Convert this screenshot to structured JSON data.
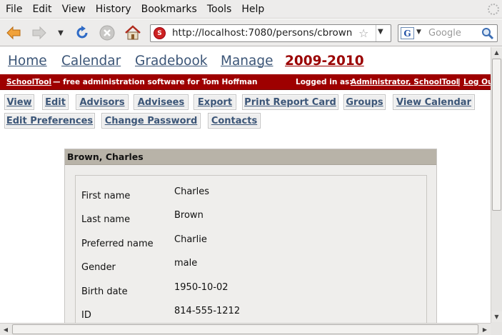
{
  "browser": {
    "menu": [
      {
        "label": "File"
      },
      {
        "label": "Edit"
      },
      {
        "label": "View"
      },
      {
        "label": "History"
      },
      {
        "label": "Bookmarks"
      },
      {
        "label": "Tools"
      },
      {
        "label": "Help"
      }
    ],
    "url": "http://localhost:7080/persons/cbrown",
    "search_placeholder": "Google",
    "search_engine_letter": "G"
  },
  "app": {
    "nav": [
      {
        "label": "Home"
      },
      {
        "label": "Calendar"
      },
      {
        "label": "Gradebook"
      },
      {
        "label": "Manage"
      },
      {
        "label": "2009-2010"
      }
    ],
    "header": {
      "brand": "SchoolTool",
      "tagline": " — free administration software for Tom Hoffman",
      "logged_in_label": "Logged in as:",
      "user": "Administrator, SchoolTool",
      "separator": "|",
      "logout": "Log Out"
    },
    "actions": [
      {
        "label": "View"
      },
      {
        "label": "Edit"
      },
      {
        "label": "Advisors"
      },
      {
        "label": "Advisees"
      },
      {
        "label": "Export"
      },
      {
        "label": "Print Report Card"
      },
      {
        "label": "Groups"
      },
      {
        "label": "View Calendar"
      },
      {
        "label": "Edit Preferences"
      },
      {
        "label": "Change Password"
      },
      {
        "label": "Contacts"
      }
    ]
  },
  "person": {
    "title": "Brown, Charles",
    "fields": [
      {
        "label": "First name",
        "value": "Charles"
      },
      {
        "label": "Last name",
        "value": "Brown"
      },
      {
        "label": "Preferred name",
        "value": "Charlie"
      },
      {
        "label": "Gender",
        "value": "male"
      },
      {
        "label": "Birth date",
        "value": "1950-10-02"
      },
      {
        "label": "ID",
        "value": "814-555-1212"
      }
    ]
  },
  "colors": {
    "header_bg": "#9e0000",
    "nav_link": "#3b5577",
    "year_link": "#9a0000",
    "panel_header": "#b8b3a8"
  }
}
